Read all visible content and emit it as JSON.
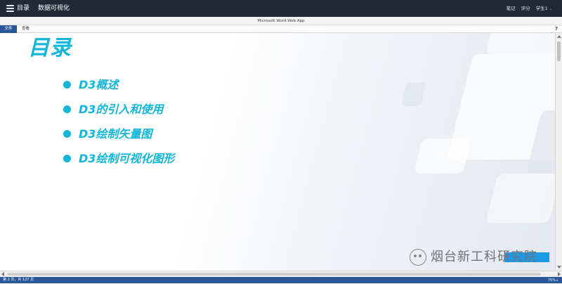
{
  "topbar": {
    "toc_label": "目录",
    "course_title": "数据可视化",
    "notes_label": "笔记",
    "review_label": "评分",
    "user_label": "学生1",
    "user_chevron": "⌄"
  },
  "app": {
    "title": "Microsoft Word Web App",
    "tab_file": "文件",
    "tab_view": "查看",
    "help": "?"
  },
  "slide": {
    "title": "目录",
    "items": [
      {
        "label": "D3概述"
      },
      {
        "label": "D3的引入和使用"
      },
      {
        "label": "D3绘制矢量图"
      },
      {
        "label": "D3绘制可视化图形"
      }
    ],
    "accent_color": "#12b6d8"
  },
  "watermark": {
    "text": "烟台新工科研究院"
  },
  "status": {
    "page_info": "第 2 页，共 127 页",
    "zoom": "75%",
    "zoom_chevron": "▾"
  }
}
